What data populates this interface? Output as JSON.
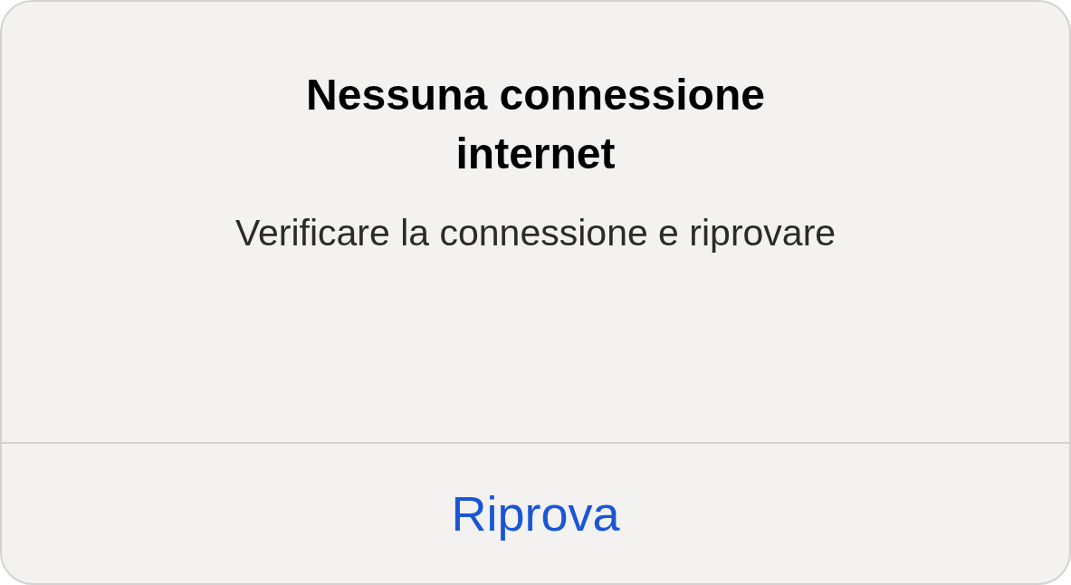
{
  "dialog": {
    "title": "Nessuna connessione internet",
    "message": "Verificare la connessione e riprovare",
    "buttons": [
      "Riprova"
    ]
  }
}
